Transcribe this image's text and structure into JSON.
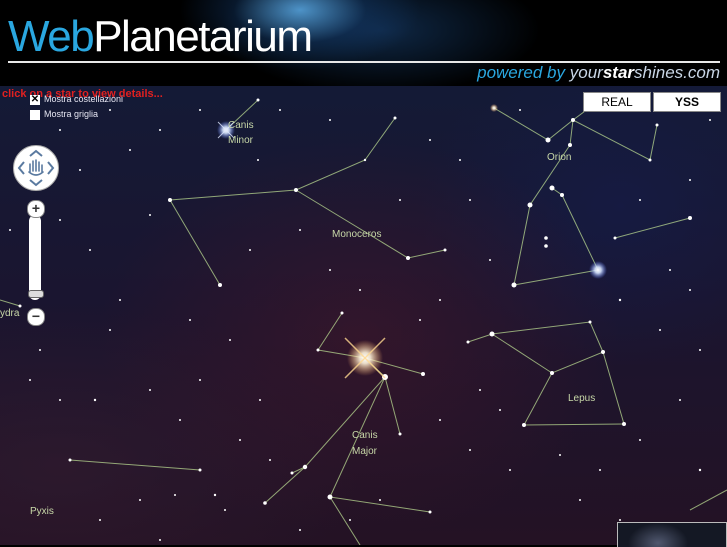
{
  "header": {
    "logo_web": "Web",
    "logo_rest": "Planetarium",
    "powered_prefix": "powered by",
    "powered_your": "your",
    "powered_star": "star",
    "powered_suffix": "shines.com"
  },
  "hint": "click on a star to view details...",
  "options": [
    {
      "label": "Mostra costellazioni",
      "checked": true
    },
    {
      "label": "Mostra griglia",
      "checked": false
    }
  ],
  "modes": {
    "real": "REAL",
    "yss": "YSS",
    "selected": "YSS"
  },
  "controls": {
    "zoom_in": "+",
    "zoom_out": "−"
  },
  "constellations": [
    {
      "label": "Canis"
    },
    {
      "label": "Minor"
    },
    {
      "label": "Orion"
    },
    {
      "label": "Monoceros"
    },
    {
      "label": "ydra"
    },
    {
      "label": "Lepus"
    },
    {
      "label": "Canis"
    },
    {
      "label": "Major"
    },
    {
      "label": "Pyxis"
    }
  ],
  "colors": {
    "accent": "#2aa7e0",
    "hint": "#e02020",
    "label": "#c8d8a8",
    "line": "#b8d890"
  }
}
